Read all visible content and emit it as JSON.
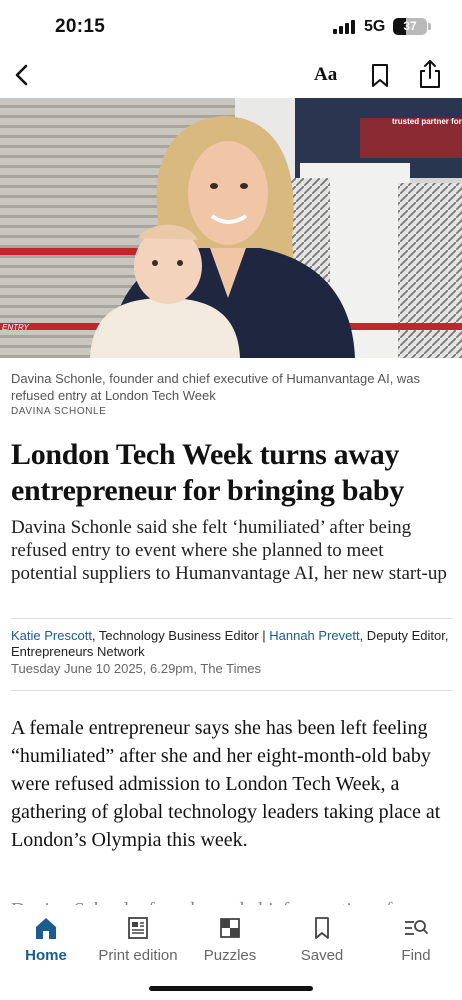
{
  "status_bar": {
    "time": "20:15",
    "network": "5G",
    "battery": "37"
  },
  "toolbar": {
    "text_size_label": "Aa",
    "icons": [
      "back-arrow-icon",
      "bookmark-icon",
      "share-icon"
    ]
  },
  "hero": {
    "signage": [
      "ENTRY",
      "trusted partner for"
    ]
  },
  "article": {
    "caption": "Davina Schonle, founder and chief executive of Humanvantage AI, was refused entry at London Tech Week",
    "photo_credit": "DAVINA SCHONLE",
    "headline": "London Tech Week turns away entrepreneur for bringing baby",
    "standfirst": "Davina Schonle said she felt ‘humiliated’ after being refused entry to event where she planned to meet potential suppliers to Humanvantage AI, her new start-up",
    "byline": {
      "author1": "Katie Prescott",
      "role1": ", Technology Business Editor | ",
      "author2": "Hannah Prevett",
      "role2": ", Deputy Editor, Entrepreneurs Network"
    },
    "dateline": "Tuesday June 10 2025, 6.29pm, The Times",
    "body": "A female entrepreneur says she has been left feeling “humiliated” after she and her eight-month-old baby were refused admission to London Tech Week, a gathering of global technology leaders taking place at London’s Olympia this week.",
    "body_next": "Davina Schonle, founder and chief executive of"
  },
  "nav": {
    "items": [
      {
        "label": "Home",
        "icon": "home-icon",
        "active": true
      },
      {
        "label": "Print edition",
        "icon": "newspaper-icon",
        "active": false
      },
      {
        "label": "Puzzles",
        "icon": "puzzle-grid-icon",
        "active": false
      },
      {
        "label": "Saved",
        "icon": "bookmark-icon",
        "active": false
      },
      {
        "label": "Find",
        "icon": "search-icon",
        "active": false
      }
    ]
  },
  "colors": {
    "accent": "#1a5d8c",
    "text": "#111111",
    "muted": "#666666"
  }
}
